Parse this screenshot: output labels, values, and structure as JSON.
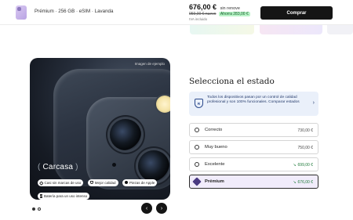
{
  "header": {
    "product_summary": "Prémium  ·  256 GB  ·  eSIM  ·  Lavanda",
    "price": "676,00 €",
    "price_suffix": "sin renove",
    "old_price": "959,00 € nuevo",
    "savings": "Ahorra 283,00 €",
    "tax_note": "IVA incluido",
    "buy_label": "Comprar"
  },
  "gallery": {
    "example_label": "Imagen de ejemplo",
    "category_open": "(",
    "category_title": "Carcasa",
    "category_close": ")",
    "chips": [
      {
        "label": "Casi sin marcas de uso",
        "icon": "heart-icon"
      },
      {
        "label": "Mejor calidad",
        "icon": "shield-icon"
      },
      {
        "label": "Piezas de Apple",
        "icon": "check-icon"
      },
      {
        "label": "Batería para un uso intenso",
        "icon": "bolt-icon"
      }
    ],
    "pager": {
      "current": 1,
      "total": 2
    },
    "prev_icon": "‹",
    "next_icon": "›"
  },
  "state_section": {
    "heading": "Selecciona el estado",
    "info_text": "Todos los dispositivos pasan por un control de calidad profesional y son 100% funcionales. Comparar estados",
    "info_chevron": "›",
    "options": [
      {
        "label": "Correcto",
        "price": "730,00 €",
        "highlight": false,
        "selected": false
      },
      {
        "label": "Muy bueno",
        "price": "750,00 €",
        "highlight": false,
        "selected": false
      },
      {
        "label": "Excelente",
        "price": "699,00 €",
        "highlight": true,
        "selected": false
      },
      {
        "label": "Prémium",
        "price": "676,00 €",
        "highlight": true,
        "selected": true
      }
    ],
    "trend_glyph": "↘"
  },
  "colors": {
    "accent_dark": "#151515",
    "savings_bg": "#b9f3c7",
    "selected_bg": "#f1ecfb",
    "info_bg": "#eaf0fa",
    "price_green": "#1e7a3a"
  }
}
